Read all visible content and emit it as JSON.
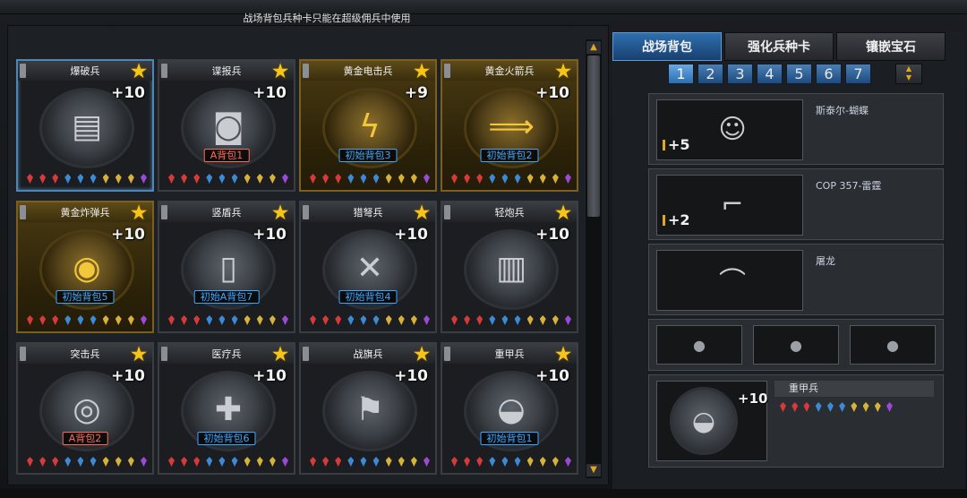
{
  "notice": "战场背包兵种卡只能在超级佣兵中使用",
  "cards": [
    {
      "name": "爆破兵",
      "level": "+10",
      "badge": "",
      "badge_color": "",
      "style": "selected",
      "icon": "explosive-pack-icon",
      "glyph": "▤"
    },
    {
      "name": "谍报兵",
      "level": "+10",
      "badge": "A背包1",
      "badge_color": "red",
      "style": "normal",
      "icon": "helmet-icon",
      "glyph": "◙"
    },
    {
      "name": "黄金电击兵",
      "level": "+9",
      "badge": "初始背包3",
      "badge_color": "blue",
      "style": "gold",
      "icon": "lightning-gauntlet-icon",
      "glyph": "ϟ"
    },
    {
      "name": "黄金火箭兵",
      "level": "+10",
      "badge": "初始背包2",
      "badge_color": "blue",
      "style": "gold",
      "icon": "rocket-launcher-icon",
      "glyph": "⟹"
    },
    {
      "name": "黄金炸弹兵",
      "level": "+10",
      "badge": "初始背包5",
      "badge_color": "blue",
      "style": "gold",
      "icon": "gold-bomb-icon",
      "glyph": "◉"
    },
    {
      "name": "竖盾兵",
      "level": "+10",
      "badge": "初始A背包7",
      "badge_color": "mixed",
      "style": "normal",
      "icon": "riot-shield-icon",
      "glyph": "▯"
    },
    {
      "name": "猎弩兵",
      "level": "+10",
      "badge": "初始背包4",
      "badge_color": "blue",
      "style": "normal",
      "icon": "crossbow-icon",
      "glyph": "✕"
    },
    {
      "name": "轻炮兵",
      "level": "+10",
      "badge": "",
      "badge_color": "",
      "style": "normal",
      "icon": "mortar-icon",
      "glyph": "▥"
    },
    {
      "name": "突击兵",
      "level": "+10",
      "badge": "A背包2",
      "badge_color": "red",
      "style": "normal",
      "icon": "scope-device-icon",
      "glyph": "◎"
    },
    {
      "name": "医疗兵",
      "level": "+10",
      "badge": "初始背包6",
      "badge_color": "blue",
      "style": "normal",
      "icon": "medkit-icon",
      "glyph": "✚"
    },
    {
      "name": "战旗兵",
      "level": "+10",
      "badge": "",
      "badge_color": "",
      "style": "normal",
      "icon": "war-banner-icon",
      "glyph": "⚑"
    },
    {
      "name": "重甲兵",
      "level": "+10",
      "badge": "初始背包1",
      "badge_color": "blue",
      "style": "normal",
      "icon": "armored-helmet-icon",
      "glyph": "◒"
    }
  ],
  "gem_colors": [
    "#d63a3a",
    "#d63a3a",
    "#d63a3a",
    "#3a8ad6",
    "#3a8ad6",
    "#3a8ad6",
    "#d6b23a",
    "#d6b23a",
    "#d6b23a",
    "#9a4ad6"
  ],
  "tabs": [
    {
      "label": "战场背包",
      "active": true
    },
    {
      "label": "强化兵种卡",
      "active": false
    },
    {
      "label": "镶嵌宝石",
      "active": false
    }
  ],
  "pages": [
    "1",
    "2",
    "3",
    "4",
    "5",
    "6",
    "7"
  ],
  "active_page": "1",
  "equipped": [
    {
      "name": "斯泰尔-蝴蝶",
      "count": "+5",
      "icon": "character-portrait-icon",
      "glyph": "☺"
    },
    {
      "name": "COP 357-雷霆",
      "count": "+2",
      "icon": "pistol-icon",
      "glyph": "⌐"
    },
    {
      "name": "屠龙",
      "count": "",
      "icon": "blade-icon",
      "glyph": "⌒"
    }
  ],
  "grenades": [
    {
      "icon": "grenade-icon",
      "glyph": "●"
    },
    {
      "icon": "flash-grenade-icon",
      "glyph": "●"
    },
    {
      "icon": "smoke-grenade-icon",
      "glyph": "●"
    }
  ],
  "troop": {
    "name": "重甲兵",
    "level": "+10",
    "icon": "armored-helmet-icon",
    "glyph": "◒"
  }
}
